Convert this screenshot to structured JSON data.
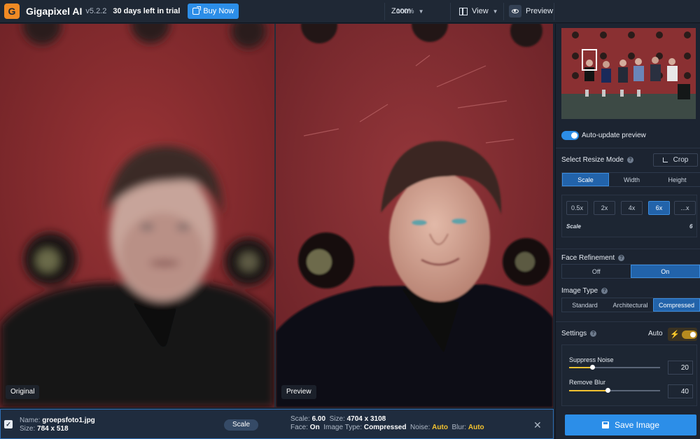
{
  "topbar": {
    "logo_letter": "G",
    "app_name": "Gigapixel AI",
    "version": "v5.2.2",
    "trial_text": "30 days left in trial",
    "buy_label": "Buy Now",
    "zoom_label": "Zoom",
    "zoom_value": "100%",
    "view_label": "View",
    "preview_label": "Preview"
  },
  "viewer": {
    "left_label": "Original",
    "right_label": "Preview"
  },
  "bottom": {
    "name_key": "Name:",
    "name_value": "groepsfoto1.jpg",
    "size_key": "Size:",
    "size_value": "784 x 518",
    "mode_pill": "Scale",
    "scale_key": "Scale:",
    "scale_value": "6.00",
    "out_size_key": "Size:",
    "out_size_value": "4704 x 3108",
    "face_key": "Face:",
    "face_value": "On",
    "type_key": "Image Type:",
    "type_value": "Compressed",
    "noise_key": "Noise:",
    "noise_value": "Auto",
    "blur_key": "Blur:",
    "blur_value": "Auto",
    "close_symbol": "✕"
  },
  "sidebar": {
    "auto_update_label": "Auto-update preview",
    "resize_mode_title": "Select Resize Mode",
    "crop_label": "Crop",
    "resize_modes": [
      "Scale",
      "Width",
      "Height"
    ],
    "scale_options": [
      "0.5x",
      "2x",
      "4x",
      "6x",
      "...x"
    ],
    "scale_footer_label": "Scale",
    "scale_footer_value": "6",
    "face_title": "Face Refinement",
    "face_options": [
      "Off",
      "On"
    ],
    "image_type_title": "Image Type",
    "image_types": [
      "Standard",
      "Architectural",
      "Compressed"
    ],
    "settings_title": "Settings",
    "auto_label": "Auto",
    "suppress_noise_label": "Suppress Noise",
    "suppress_noise_value": "20",
    "remove_blur_label": "Remove Blur",
    "remove_blur_value": "40",
    "save_label": "Save Image"
  },
  "colors": {
    "accent": "#2c8ee8",
    "selected": "#2263aa",
    "warning": "#f2c230",
    "logo": "#f08a24"
  },
  "sliders": {
    "suppress_noise_fraction": 0.25,
    "remove_blur_fraction": 0.42
  },
  "selection": {
    "resize_mode": "Scale",
    "scale": "6x",
    "face_refinement": "On",
    "image_type": "Compressed"
  }
}
